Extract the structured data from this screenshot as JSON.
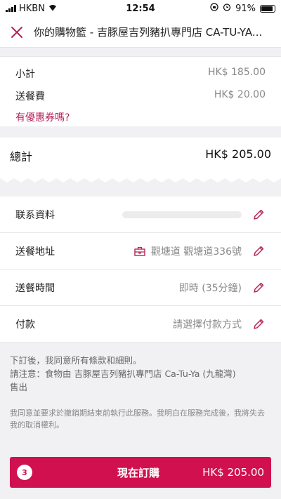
{
  "status_bar": {
    "carrier": "HKBN",
    "time": "12:54",
    "battery": "91%"
  },
  "header": {
    "title": "你的購物籃 - 吉豚屋吉列豬扒專門店 CA-TU-YA..."
  },
  "summary": {
    "subtotal_label": "小計",
    "subtotal_value": "HK$ 185.00",
    "delivery_fee_label": "送餐費",
    "delivery_fee_value": "HK$ 20.00",
    "coupon_link": "有優惠券嗎?"
  },
  "total": {
    "label": "總計",
    "value": "HK$ 205.00"
  },
  "details": {
    "contact_label": "联系資料",
    "address_label": "送餐地址",
    "address_value": "觀塘道 觀塘道336號",
    "time_label": "送餐時間",
    "time_value": "即時 (35分鐘)",
    "payment_label": "付款",
    "payment_value": "請選擇付款方式"
  },
  "terms": {
    "line1": "下訂後，我同意所有條款和細則。",
    "line2": "請注意：食物由 吉豚屋吉列豬扒專門店 Ca-Tu-Ya (九龍灣)",
    "line3": "售出",
    "small": "我同意並要求於撤銷期結束前執行此服務。我明白在服務完成後，我將失去我的取消權利。"
  },
  "order_button": {
    "count": "3",
    "label": "現在訂購",
    "total": "HK$ 205.00"
  },
  "colors": {
    "accent": "#d0104f",
    "link": "#b8235a"
  }
}
